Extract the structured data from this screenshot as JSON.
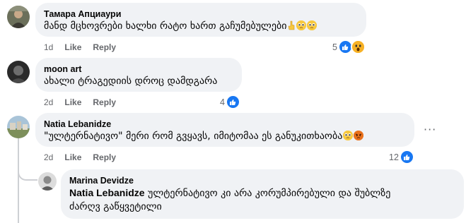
{
  "comments": [
    {
      "author": "Тамара Апциаури",
      "text": "მანდ მცხოვრები ხალხი რატო ხართ გაჩუმებულები",
      "time": "1d",
      "like": "Like",
      "reply": "Reply",
      "reaction_count": "5",
      "reaction_icons": [
        "like-icon",
        "wow-icon"
      ],
      "text_emojis": [
        "pointing-hand-emoji",
        "pleading-face-emoji",
        "pleading-face-emoji"
      ]
    },
    {
      "author": "moon art",
      "text": "ახალი ტრაგედიის დროც დამდგარა",
      "time": "2d",
      "like": "Like",
      "reply": "Reply",
      "reaction_count": "4",
      "reaction_icons": [
        "like-icon"
      ]
    },
    {
      "author": "Natia Lebanidze",
      "text": "\"ულტერნატივო\" მერი რომ გვყავს, იმიტომაა ეს განუკითხაობა",
      "time": "2d",
      "like": "Like",
      "reply": "Reply",
      "reaction_count": "12",
      "reaction_icons": [
        "like-icon"
      ],
      "text_emojis": [
        "pleading-face-emoji",
        "angry-face-emoji"
      ],
      "more": "···"
    },
    {
      "author": "Marina Devidze",
      "mention": "Natia Lebanidze",
      "text_line1": "ულტერნატივო კი არა კორუმპირებული და შუბლზე",
      "text_line2": "ძარღვ გაწყვეტილი"
    }
  ],
  "colors": {
    "bubble": "#f0f2f5",
    "meta": "#65676b",
    "like_blue": "#1877f2",
    "thread_line": "#ced0d4"
  }
}
